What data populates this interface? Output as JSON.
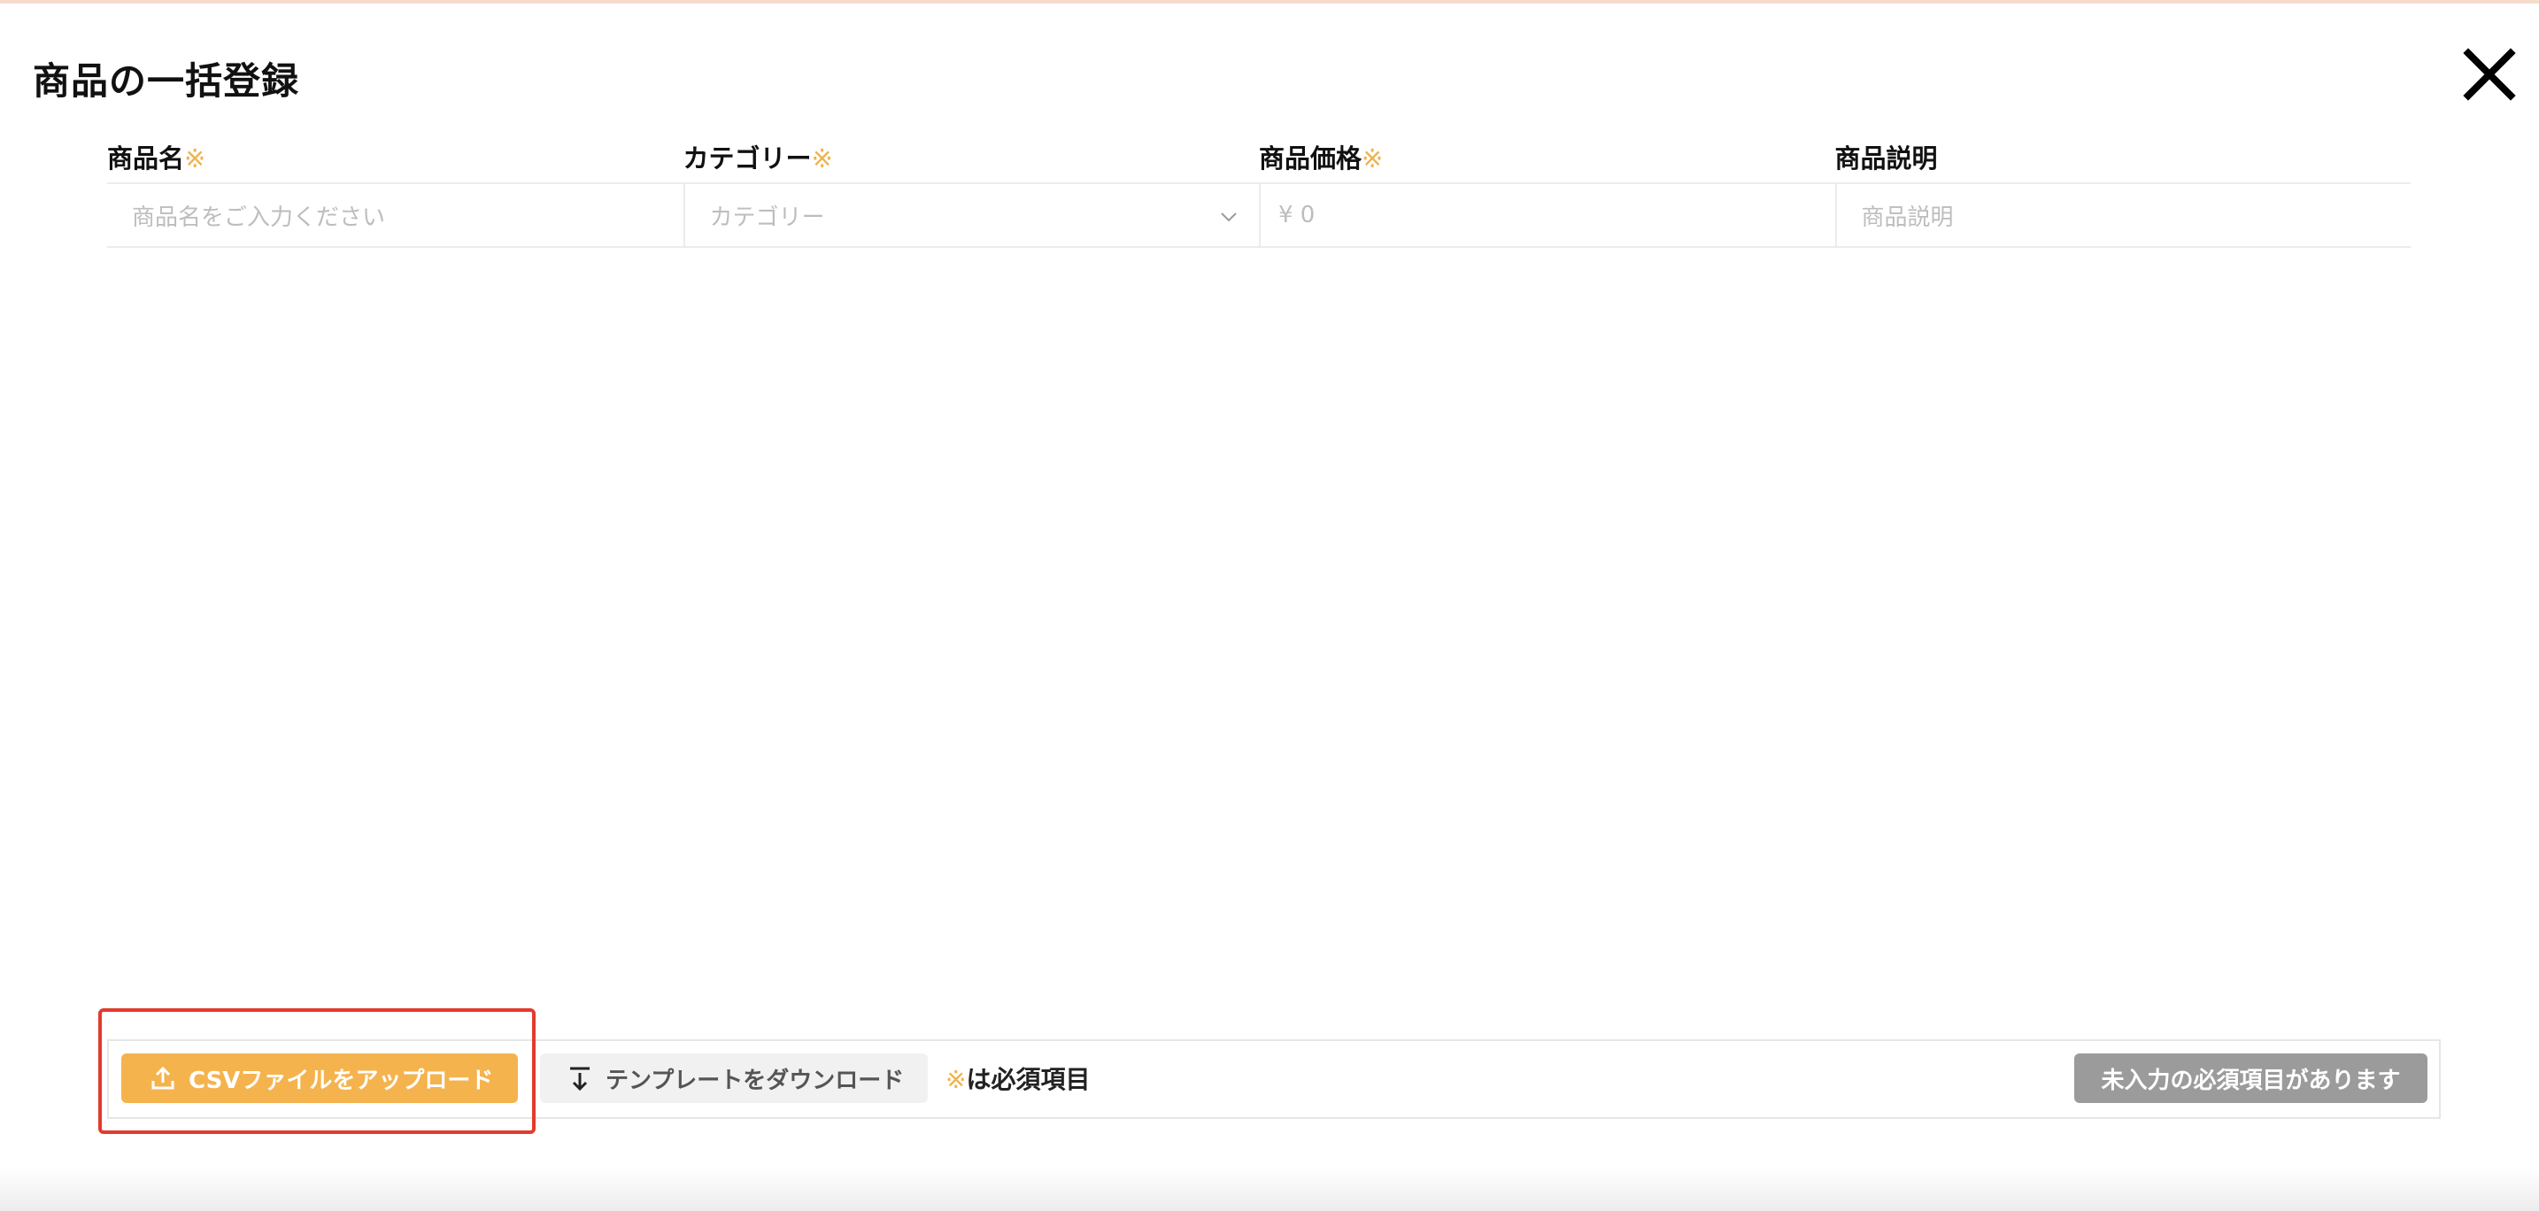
{
  "modal": {
    "title": "商品の一括登録"
  },
  "form": {
    "required_mark": "※",
    "columns": [
      {
        "label": "商品名",
        "required": true,
        "placeholder": "商品名をご入力ください"
      },
      {
        "label": "カテゴリー",
        "required": true,
        "placeholder": "カテゴリー"
      },
      {
        "label": "商品価格",
        "required": true,
        "placeholder": "¥ 0"
      },
      {
        "label": "商品説明",
        "required": false,
        "placeholder": "商品説明"
      }
    ]
  },
  "footer": {
    "upload_label": "CSVファイルをアップロード",
    "template_label": "テンプレートをダウンロード",
    "required_note_mark": "※",
    "required_note_text": "は必須項目",
    "submit_label": "未入力の必須項目があります"
  },
  "colors": {
    "accent": "#f5b34e",
    "required": "#f0b34b",
    "highlight": "#e23b2e",
    "disabled": "#9b9b9b"
  },
  "icons": {
    "close": "close-icon",
    "upload": "upload-icon",
    "download": "download-icon",
    "chevron": "chevron-down-icon"
  }
}
